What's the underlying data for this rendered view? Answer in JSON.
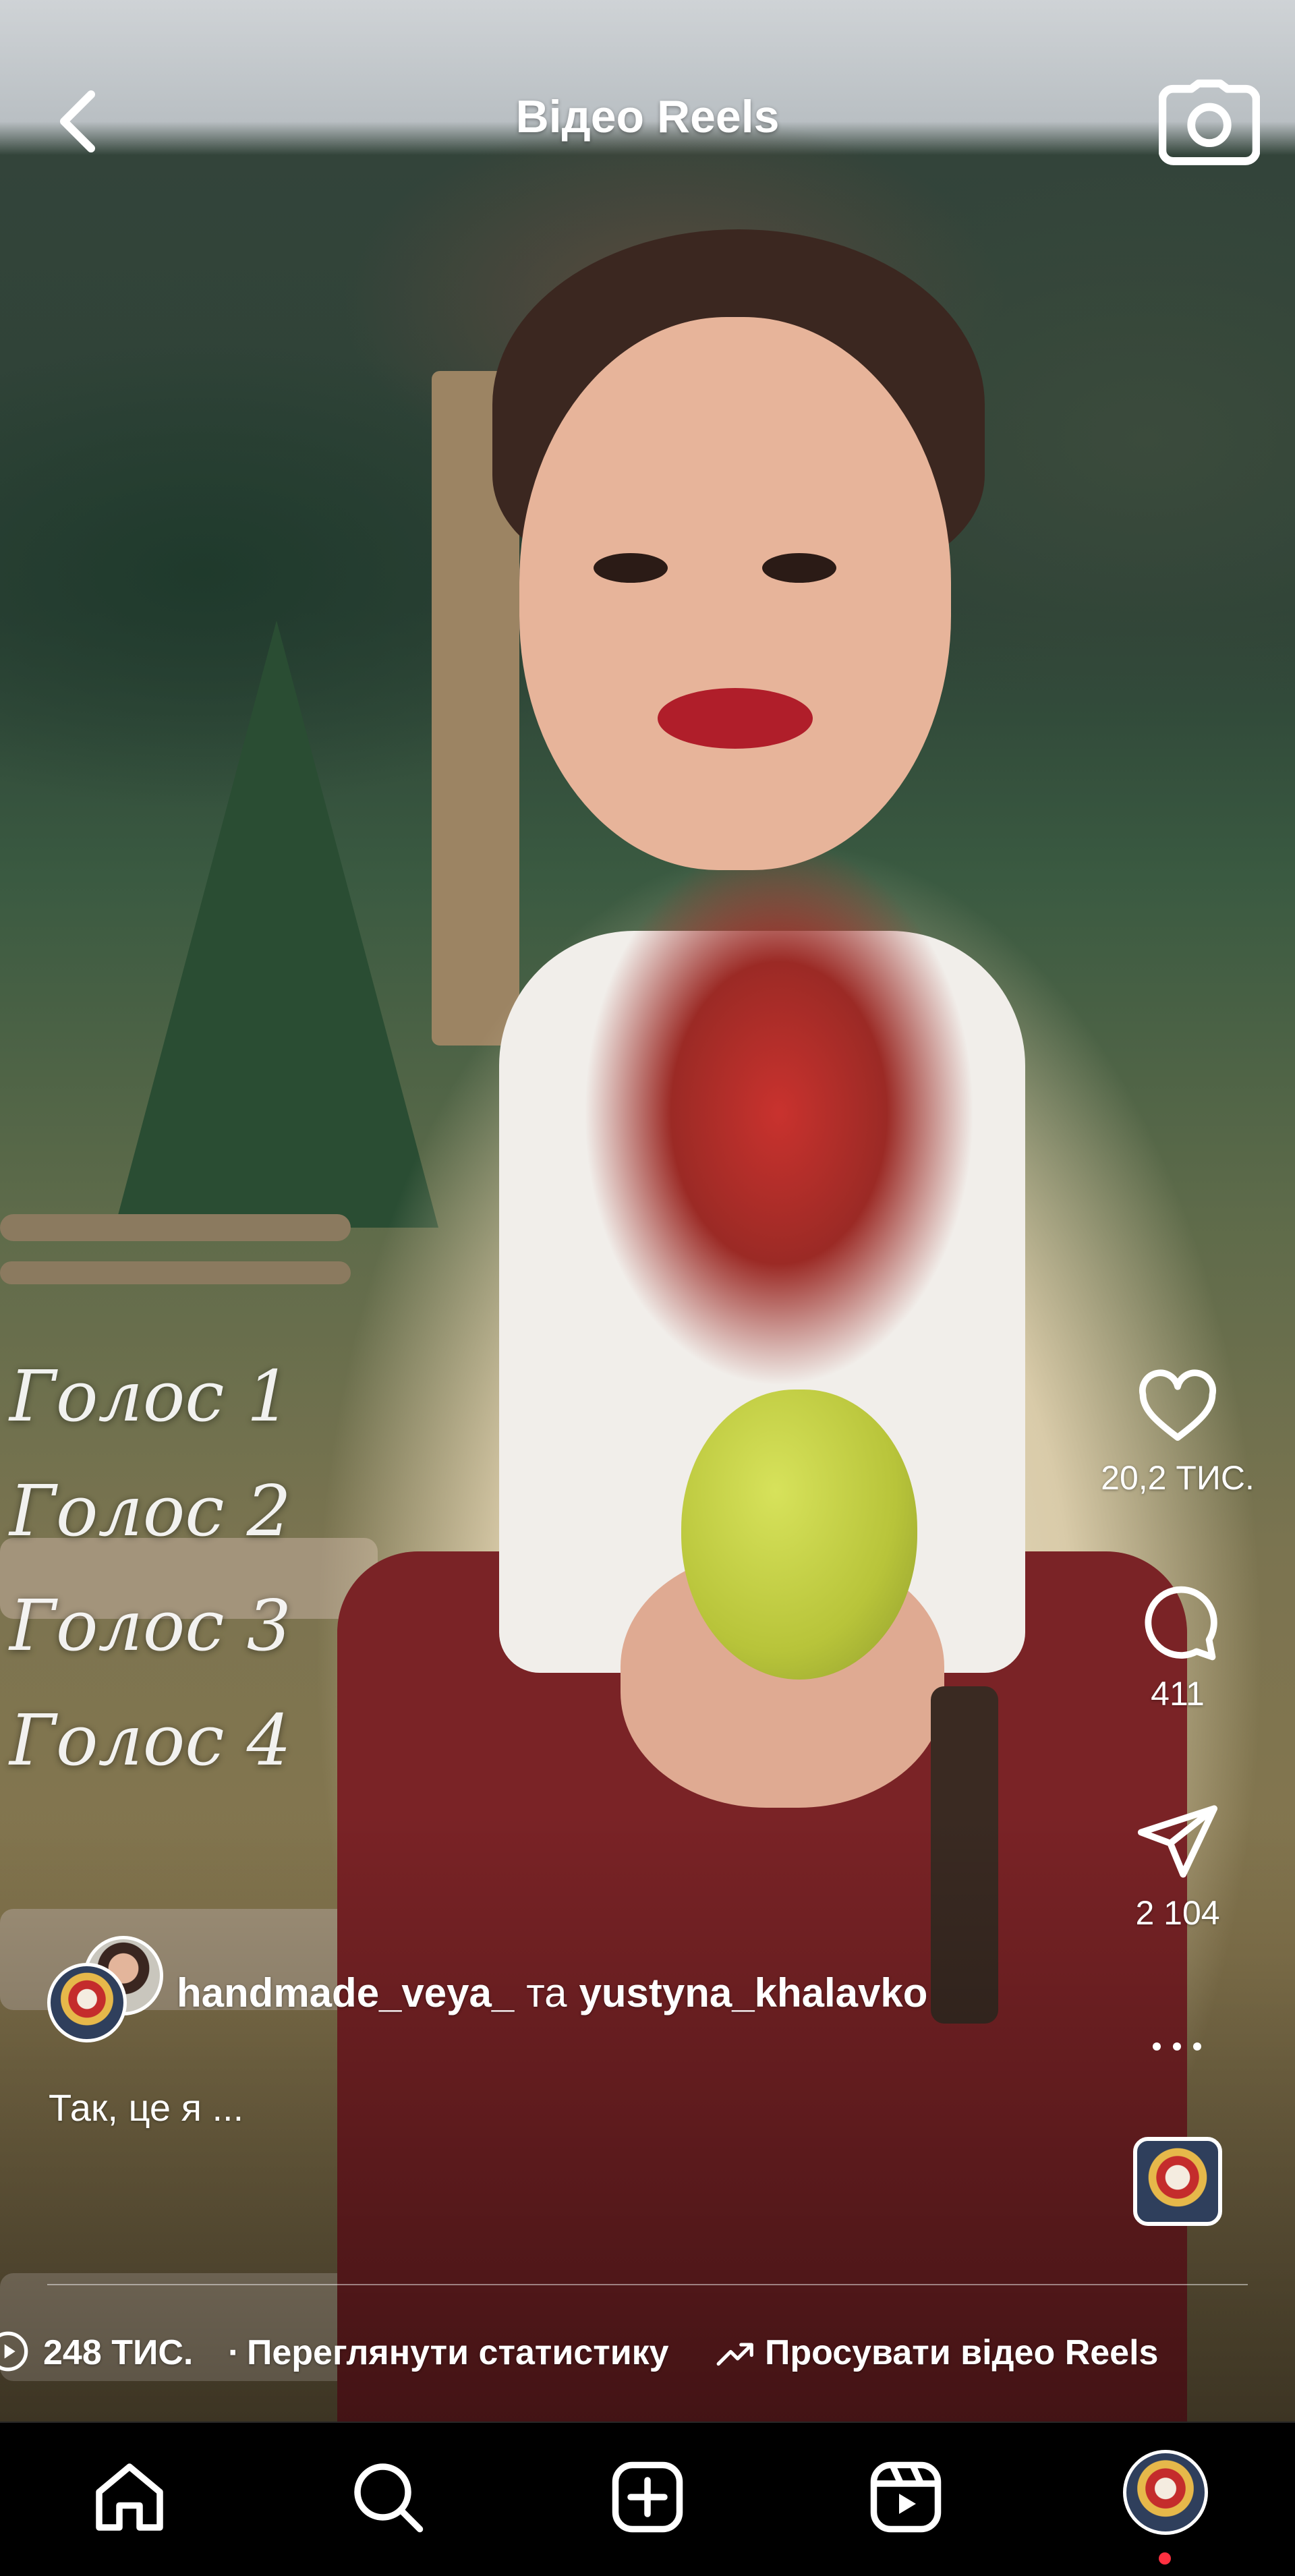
{
  "header": {
    "title": "Відео Reels",
    "back_icon": "chevron-left-icon",
    "camera_icon": "camera-icon"
  },
  "overlay_text": {
    "voices": [
      "Голос 1",
      "Голос 2",
      "Голос 3",
      "Голос 4"
    ]
  },
  "actions": {
    "likes": "20,2 ТИС.",
    "comments": "411",
    "shares": "2 104"
  },
  "post": {
    "author_1": "handmade_veya_",
    "joiner": "та",
    "author_2": "yustyna_khalavko",
    "caption": "Так, це я ..."
  },
  "stats": {
    "views": "248 ТИС.",
    "separator": "·",
    "insights_label": "Переглянути статистику",
    "boost_label": "Просувати відео Reels"
  },
  "tabbar": {
    "items": [
      "home-icon",
      "search-icon",
      "create-icon",
      "reels-icon",
      "profile-avatar"
    ],
    "active_color": "#ffffff",
    "notification_color": "#ff3040"
  }
}
